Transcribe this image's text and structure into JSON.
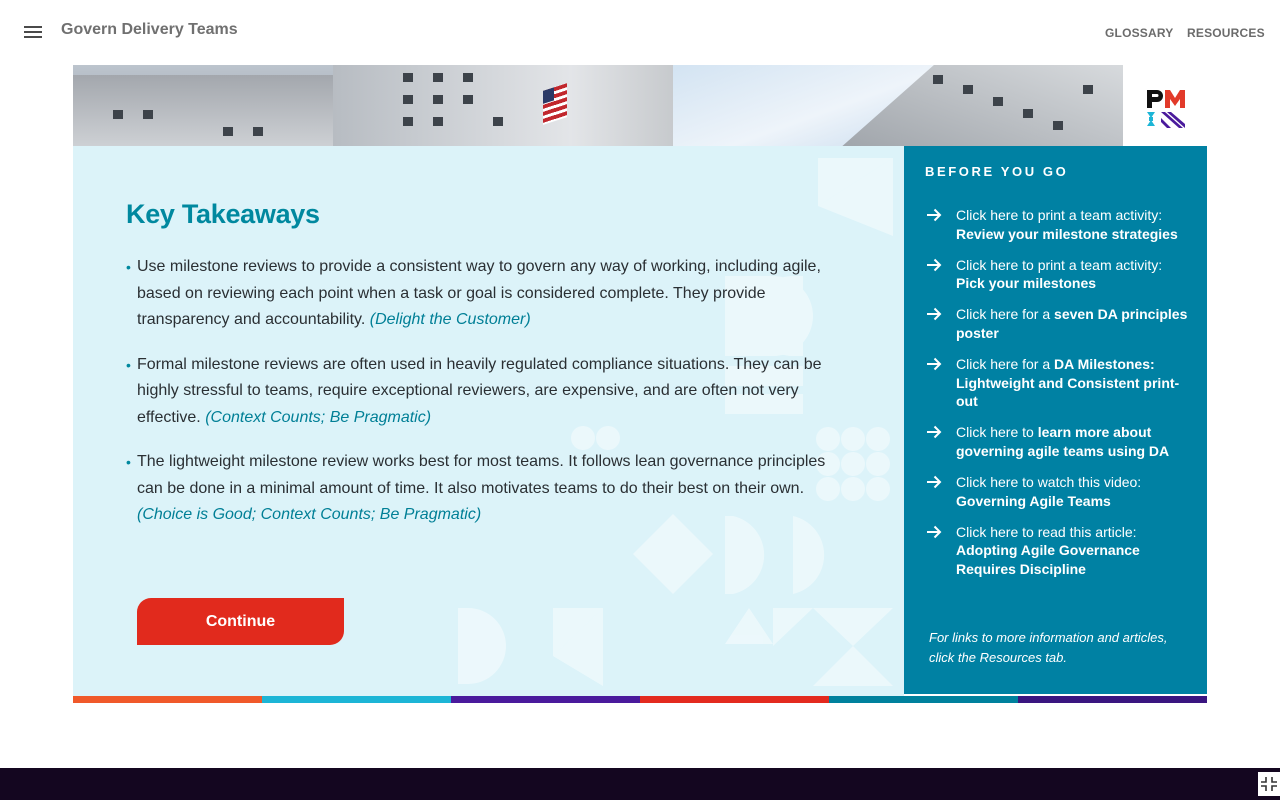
{
  "header": {
    "title": "Govern Delivery Teams",
    "nav": [
      {
        "label": "GLOSSARY"
      },
      {
        "label": "RESOURCES"
      }
    ]
  },
  "main": {
    "heading": "Key Takeaways",
    "bullets": [
      {
        "text": "Use milestone reviews to provide a consistent way to govern any way of working, including agile, based on reviewing each point when a task or goal is considered complete. They provide transparency and accountability. ",
        "principle": "(Delight the Customer)"
      },
      {
        "text": "Formal milestone reviews are often used in heavily regulated compliance situations. They can be highly stressful to teams, require exceptional reviewers, are expensive, and are often not very effective. ",
        "principle": "(Context Counts; Be Pragmatic)"
      },
      {
        "text": "The lightweight milestone review works best for most teams. It follows lean governance principles can be done in a minimal amount of time. It also motivates teams to do their best on their own. ",
        "principle": "(Choice is Good; Context Counts; Be Pragmatic)"
      }
    ],
    "continue_label": "Continue"
  },
  "sidebar": {
    "title": "BEFORE YOU GO",
    "links": [
      {
        "prefix": "Click here to print a team activity: ",
        "bold": "Review your milestone strategies"
      },
      {
        "prefix": "Click here to print a team activity: ",
        "bold": "Pick your milestones"
      },
      {
        "prefix": "Click here for a ",
        "bold": "seven DA principles poster"
      },
      {
        "prefix": "Click here for a ",
        "bold": "DA Milestones: Lightweight and Consistent print-out"
      },
      {
        "prefix": "Click here to ",
        "bold": "learn more about governing agile teams using DA"
      },
      {
        "prefix": "Click here to watch this video: ",
        "bold": "Governing Agile Teams"
      },
      {
        "prefix": "Click here to read this article: ",
        "bold": "Adopting Agile Governance Requires Discipline"
      }
    ],
    "note": "For links to more information and articles, click the Resources tab."
  },
  "colors": {
    "accent_teal": "#00889f",
    "sidebar_bg": "#0081a3",
    "continue_bg": "#e12a1d",
    "panel_bg": "#dcf3f9",
    "colorbar": [
      "#f0592a",
      "#1cb5d6",
      "#4a1a9c",
      "#e32a1f",
      "#00819d",
      "#3a1580"
    ]
  },
  "icons": {
    "menu": "hamburger-menu-icon",
    "logo": "pmi-logo",
    "link_arrow": "arrow-right-icon",
    "exit_fullscreen": "exit-fullscreen-icon"
  }
}
